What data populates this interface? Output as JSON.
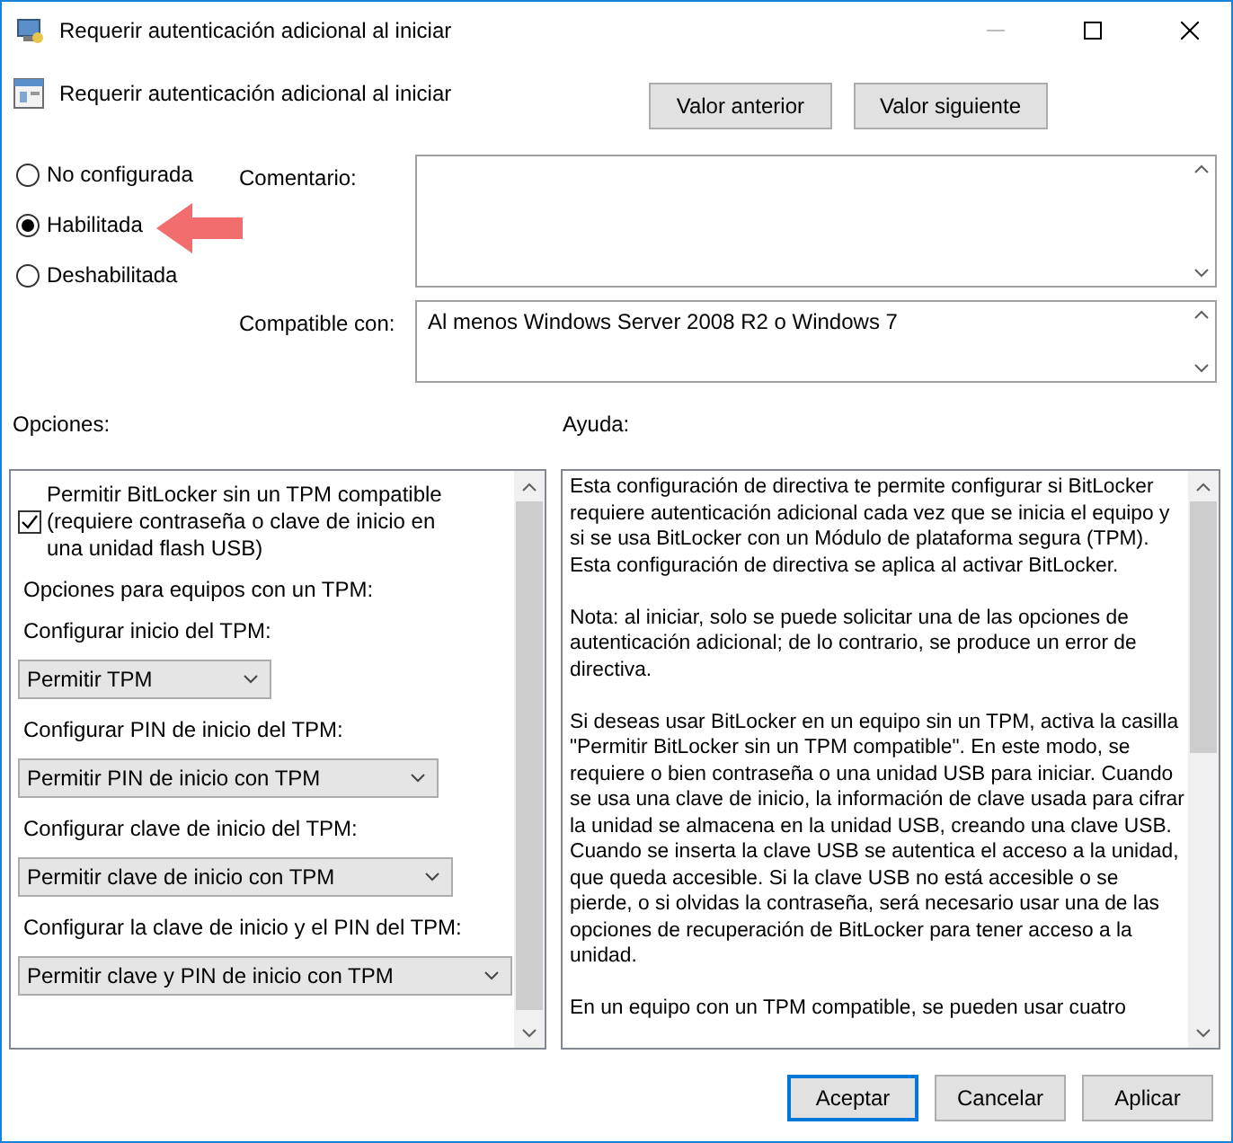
{
  "window": {
    "title": "Requerir autenticación adicional al iniciar"
  },
  "policy_title": "Requerir autenticación adicional al iniciar",
  "nav_buttons": [
    "Valor anterior",
    "Valor siguiente"
  ],
  "state_options": [
    {
      "label": "No configurada",
      "selected": false
    },
    {
      "label": "Habilitada",
      "selected": true
    },
    {
      "label": "Deshabilitada",
      "selected": false
    }
  ],
  "comment": {
    "label": "Comentario:"
  },
  "compatible": {
    "label": "Compatible con:",
    "value": "Al menos Windows Server 2008 R2 o Windows 7"
  },
  "options": {
    "label": "Opciones:",
    "items": [
      {
        "kind": "checkbox",
        "label": "Permitir BitLocker sin un TPM compatible (requiere contraseña o clave de inicio en una unidad flash USB)",
        "checked": true
      },
      {
        "kind": "text",
        "label": "Opciones para equipos con un TPM:"
      },
      {
        "kind": "text",
        "label": "Configurar inicio del TPM:"
      },
      {
        "kind": "dropdown",
        "value": "Permitir TPM"
      },
      {
        "kind": "text",
        "label": "Configurar PIN de inicio del TPM:"
      },
      {
        "kind": "dropdown",
        "value": "Permitir PIN de inicio con TPM"
      },
      {
        "kind": "text",
        "label": "Configurar clave de inicio del TPM:"
      },
      {
        "kind": "dropdown",
        "value": "Permitir clave de inicio con TPM"
      },
      {
        "kind": "text",
        "label": "Configurar la clave de inicio y el PIN del TPM:"
      },
      {
        "kind": "dropdown",
        "value": "Permitir clave y PIN de inicio con TPM"
      }
    ]
  },
  "help": {
    "label": "Ayuda:",
    "paragraphs": [
      "Esta configuración de directiva te permite configurar si BitLocker requiere autenticación adicional cada vez que se inicia el equipo y si se usa BitLocker con un Módulo de plataforma segura (TPM). Esta configuración de directiva se aplica al activar BitLocker.",
      "Nota: al iniciar, solo se puede solicitar una de las opciones de autenticación adicional; de lo contrario, se produce un error de directiva.",
      "Si deseas usar BitLocker en un equipo sin un TPM, activa la casilla \"Permitir BitLocker sin un TPM compatible\". En este modo, se requiere o bien contraseña o una unidad USB para iniciar. Cuando se usa una clave de inicio, la información de clave usada para cifrar la unidad se almacena en la unidad USB, creando una clave USB. Cuando se inserta la clave USB se autentica el acceso a la unidad, que queda accesible. Si la clave USB no está accesible o se pierde, o si olvidas la contraseña, será necesario usar una de las opciones de recuperación de BitLocker para tener acceso a la unidad.",
      "En un equipo con un TPM compatible, se pueden usar cuatro"
    ]
  },
  "footer_buttons": [
    {
      "label": "Aceptar",
      "default": true
    },
    {
      "label": "Cancelar",
      "default": false
    },
    {
      "label": "Aplicar",
      "default": false
    }
  ]
}
